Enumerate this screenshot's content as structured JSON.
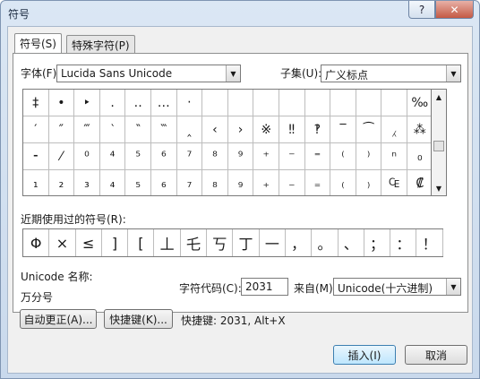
{
  "window": {
    "title": "符号",
    "help_label": "?",
    "close_label": "✕"
  },
  "tabs": [
    {
      "label": "符号(S)"
    },
    {
      "label": "特殊字符(P)"
    }
  ],
  "font": {
    "label": "字体(F):",
    "value": "Lucida Sans Unicode"
  },
  "subset": {
    "label": "子集(U):",
    "value": "广义标点"
  },
  "grid": {
    "rows": [
      [
        "‡",
        "•",
        "‣",
        "․",
        "‥",
        "…",
        "‧",
        "",
        "",
        "",
        "",
        "",
        "",
        "",
        "",
        "‰",
        "‱"
      ],
      [
        "′",
        "″",
        "‴",
        "‵",
        "‶",
        "‷",
        "‸",
        "‹",
        "›",
        "※",
        "‼",
        "‽",
        "‾",
        "⁀",
        "⁁",
        "⁂"
      ],
      [
        "⁃",
        "⁄",
        "⁰",
        "⁴",
        "⁵",
        "⁶",
        "⁷",
        "⁸",
        "⁹",
        "⁺",
        "⁻",
        "⁼",
        "⁽",
        "⁾",
        "ⁿ",
        "₀"
      ],
      [
        "₁",
        "₂",
        "₃",
        "₄",
        "₅",
        "₆",
        "₇",
        "₈",
        "₉",
        "₊",
        "₋",
        "₌",
        "₍",
        "₎",
        "₠",
        "₡"
      ]
    ],
    "selected_symbol": "‱"
  },
  "recent": {
    "label": "近期使用过的符号(R):",
    "symbols": [
      "Φ",
      "×",
      "≤",
      "]",
      "[",
      "丄",
      "乇",
      "丂",
      "丁",
      "一",
      "，",
      "。",
      "、",
      "；",
      "：",
      "！"
    ]
  },
  "unicode_name": {
    "label": "Unicode 名称:",
    "value": "万分号"
  },
  "char_code": {
    "label": "字符代码(C):",
    "value": "2031"
  },
  "from": {
    "label": "来自(M):",
    "value": "Unicode(十六进制)"
  },
  "buttons": {
    "autocorrect": "自动更正(A)...",
    "shortcut_key": "快捷键(K)...",
    "insert": "插入(I)",
    "cancel": "取消"
  },
  "shortcut_text": "快捷键: 2031, Alt+X"
}
